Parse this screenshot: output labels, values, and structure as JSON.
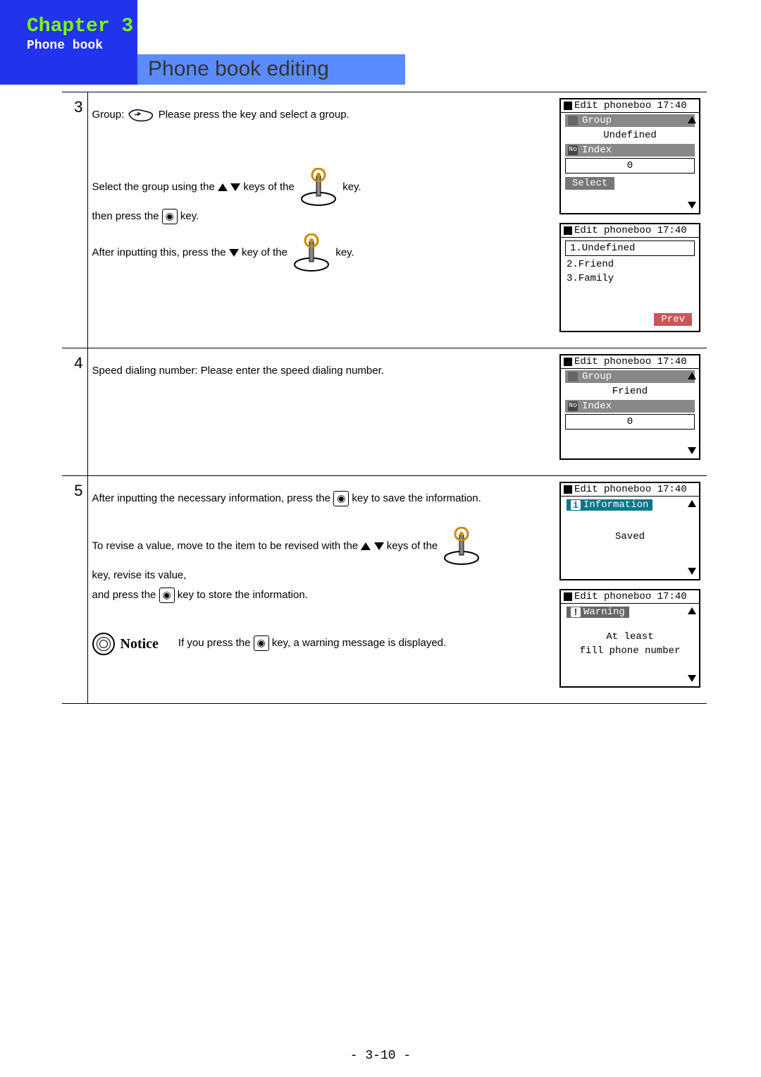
{
  "header": {
    "chapter": "Chapter 3",
    "section": "Phone book",
    "title": "Phone book editing"
  },
  "steps": {
    "s3": {
      "num": "3",
      "l1a": "Group:",
      "l1b": "Please press the   key and select a group.",
      "l2a": "Select the group using the",
      "l2b": "keys of the",
      "l2c": "key.",
      "l3a": "then press the",
      "l3b": "key.",
      "l4a": "After inputting this, press the",
      "l4b": "key of the",
      "l4c": "key."
    },
    "s4": {
      "num": "4",
      "l1": "Speed dialing number:  Please enter the speed dialing number."
    },
    "s5": {
      "num": "5",
      "l1a": "After inputting the necessary information,  press the",
      "l1b": "key to save the information.",
      "l2a": "To revise a value, move to the item to be revised with the",
      "l2b": "keys of the",
      "l3": "key, revise its value,",
      "l4a": "and press the",
      "l4b": "key to store the information.",
      "notice": "Notice",
      "n1a": "If you press the",
      "n1b": "key, a warning message is displayed."
    }
  },
  "screens": {
    "a": {
      "title": "Edit phoneboo 17:40",
      "h1": "Group",
      "v1": "Undefined",
      "h2": "Index",
      "v2": "0",
      "btn": "Select"
    },
    "b": {
      "title": "Edit phoneboo 17:40",
      "i1": "1.Undefined",
      "i2": "2.Friend",
      "i3": "3.Family",
      "btn": "Prev"
    },
    "c": {
      "title": "Edit phoneboo 17:40",
      "h1": "Group",
      "v1": "Friend",
      "h2": "Index",
      "v2": "0"
    },
    "d": {
      "title": "Edit phoneboo 17:40",
      "h": "Information",
      "msg": "Saved"
    },
    "e": {
      "title": "Edit phoneboo 17:40",
      "h": "Warning",
      "m1": "At least",
      "m2": "fill phone number"
    }
  },
  "pageno": "- 3-10 -"
}
